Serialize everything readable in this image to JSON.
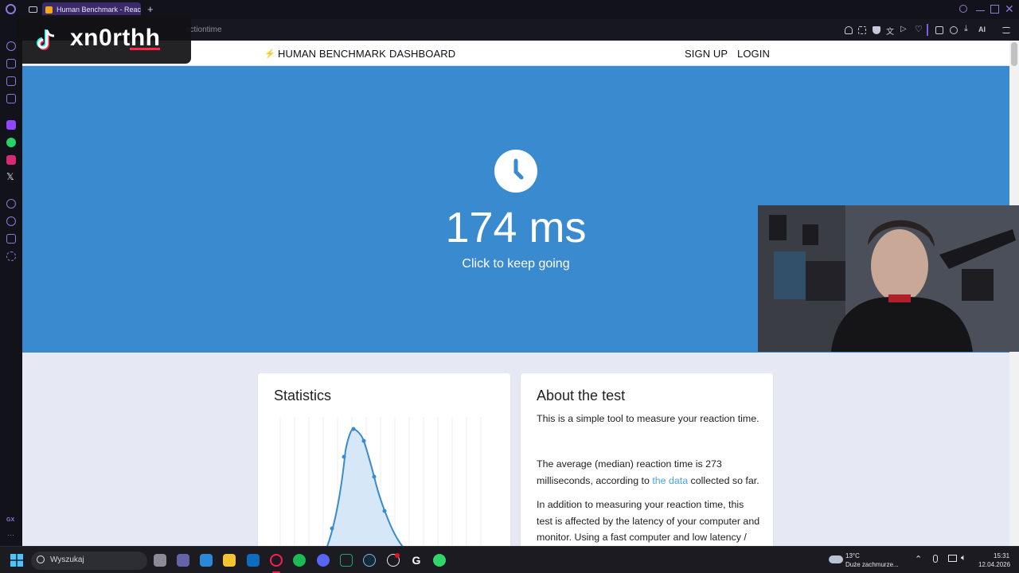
{
  "browser": {
    "tab_title": "Human Benchmark - Reac",
    "new_tab_symbol": "+",
    "url_fragment": "actiontime",
    "ai_label": "AI",
    "sidebar_bottom_label": "GX"
  },
  "nav": {
    "brand": "HUMAN BENCHMARK",
    "dashboard": "DASHBOARD",
    "signup": "SIGN UP",
    "login": "LOGIN"
  },
  "hero": {
    "icon": "clock-icon",
    "result": "174 ms",
    "hint": "Click to keep going",
    "background": "#3a8acf"
  },
  "statistics": {
    "title": "Statistics"
  },
  "about": {
    "title": "About the test",
    "p1": "This is a simple tool to measure your reaction time.",
    "p2_before": "The average (median) reaction time is 273 milliseconds, according to ",
    "p2_link": "the data",
    "p2_after": " collected so far.",
    "p3": "In addition to measuring your reaction time, this test is affected by the latency of your computer and monitor. Using a fast computer and low latency / high framerate monitor will improve your score."
  },
  "overlay": {
    "username": "xn0rthh"
  },
  "taskbar": {
    "search_placeholder": "Wyszukaj",
    "weather_temp": "13°C",
    "weather_desc": "Duże zachmurze...",
    "time": "15:31",
    "date": "12.04.2026"
  }
}
